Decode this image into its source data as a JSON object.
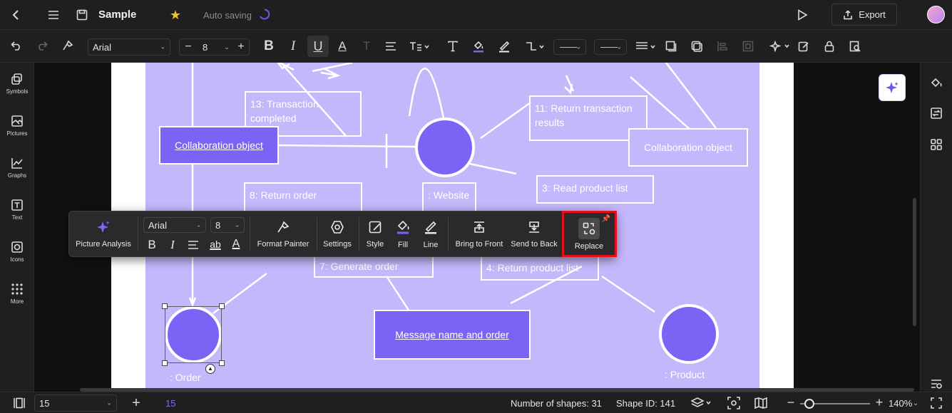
{
  "header": {
    "doc_title": "Sample",
    "autosave": "Auto saving",
    "export_label": "Export"
  },
  "toolbar": {
    "font_family": "Arial",
    "font_size": "8"
  },
  "sidebar": {
    "items": [
      {
        "label": "Symbols",
        "icon": "symbols-icon"
      },
      {
        "label": "Pictures",
        "icon": "pictures-icon"
      },
      {
        "label": "Graphs",
        "icon": "graphs-icon"
      },
      {
        "label": "Text",
        "icon": "text-icon"
      },
      {
        "label": "Icons",
        "icon": "icons-icon"
      },
      {
        "label": "More",
        "icon": "more-icon"
      }
    ]
  },
  "diagram": {
    "boxes": {
      "b13": "13: Transaction completed",
      "b11": "11: Return transaction results",
      "b8": "8: Return order",
      "website": ": Website",
      "b3": "3: Read product list",
      "b7": "7: Generate order",
      "b4": "4: Return product list"
    },
    "cards": {
      "collab_left": "Collaboration object",
      "collab_right": "Collaboration object",
      "message": "Message name and order"
    },
    "labels": {
      "order": ": Order",
      "product": ": Product"
    }
  },
  "floating_toolbar": {
    "picture_analysis": "Picture Analysis",
    "font_family": "Arial",
    "font_size": "8",
    "format_painter": "Format Painter",
    "settings": "Settings",
    "style": "Style",
    "fill": "Fill",
    "line": "Line",
    "bring_to_front": "Bring to Front",
    "send_to_back": "Send to Back",
    "replace": "Replace"
  },
  "status": {
    "page_select": "15",
    "page_number": "15",
    "shapes_count": "Number of shapes: 31",
    "shape_id": "Shape ID: 141",
    "zoom": "140%"
  },
  "colors": {
    "accent": "#7d62f6",
    "diagram_bg": "#c5b7fb",
    "highlight": "#e3101c"
  }
}
